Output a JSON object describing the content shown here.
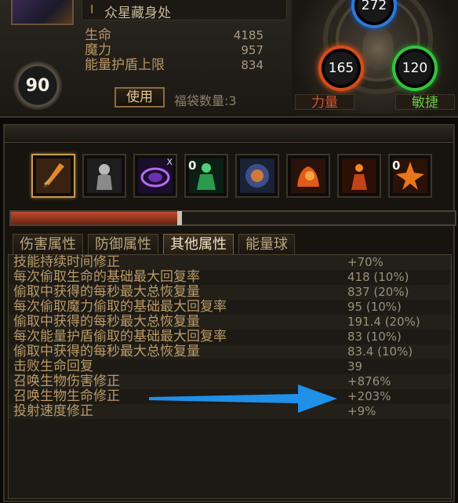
{
  "header": {
    "name": "众星藏身处",
    "level": "90",
    "use_button": "使用",
    "bag_count_label": "福袋数量:3"
  },
  "core_stats": [
    {
      "label": "生命",
      "value": "4185"
    },
    {
      "label": "魔力",
      "value": "957"
    },
    {
      "label": "能量护盾上限",
      "value": "834"
    }
  ],
  "attributes": {
    "intelligence": "272",
    "strength": "165",
    "dexterity": "120",
    "strength_label": "力量",
    "dexterity_label": "敏捷"
  },
  "skills": [
    {
      "icon": "sword-icon",
      "selected": true,
      "count": ""
    },
    {
      "icon": "ghost-icon",
      "selected": false,
      "count": ""
    },
    {
      "icon": "vortex-icon",
      "selected": false,
      "count": "",
      "corner": "X"
    },
    {
      "icon": "spirit-icon",
      "selected": false,
      "count": "0"
    },
    {
      "icon": "portal-icon",
      "selected": false,
      "count": ""
    },
    {
      "icon": "fist-fire-icon",
      "selected": false,
      "count": ""
    },
    {
      "icon": "flame-body-icon",
      "selected": false,
      "count": ""
    },
    {
      "icon": "fire-burst-icon",
      "selected": false,
      "count": "0"
    }
  ],
  "progress": {
    "fill_fraction": 0.38
  },
  "tabs": [
    {
      "label": "伤害属性",
      "active": false
    },
    {
      "label": "防御属性",
      "active": false
    },
    {
      "label": "其他属性",
      "active": true
    },
    {
      "label": "能量球",
      "active": false
    }
  ],
  "rows": [
    {
      "label": "技能持续时间修正",
      "value": "+70%"
    },
    {
      "label": "每次偷取生命的基础最大回复率",
      "value": "418 (10%)"
    },
    {
      "label": "偷取中获得的每秒最大总恢复量",
      "value": "837 (20%)"
    },
    {
      "label": "每次偷取魔力偷取的基础最大回复率",
      "value": "95 (10%)"
    },
    {
      "label": "偷取中获得的每秒最大总恢复量",
      "value": "191.4 (20%)"
    },
    {
      "label": "每次能量护盾偷取的基础最大回复率",
      "value": "83 (10%)"
    },
    {
      "label": "偷取中获得的每秒最大总恢复量",
      "value": "83.4 (10%)"
    },
    {
      "label": "击败生命回复",
      "value": "39"
    },
    {
      "label": "召唤生物伤害修正",
      "value": "+876%"
    },
    {
      "label": "召唤生物生命修正",
      "value": "+203%"
    },
    {
      "label": "投射速度修正",
      "value": "+9%"
    }
  ],
  "colors": {
    "accent": "#c69a52",
    "arrow": "#1f8fe8"
  }
}
